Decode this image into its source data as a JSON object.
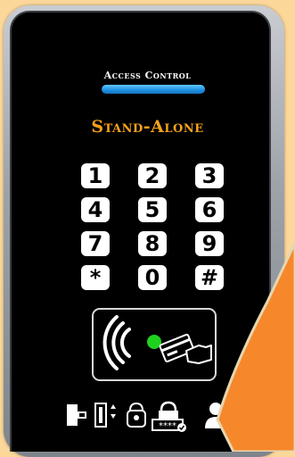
{
  "header": {
    "brand_label": "Access Control",
    "product_label": "Stand-Alone"
  },
  "keypad": {
    "keys": [
      "1",
      "2",
      "3",
      "4",
      "5",
      "6",
      "7",
      "8",
      "9",
      "*",
      "0",
      "#"
    ]
  },
  "reader": {
    "led_color": "#1fd11f"
  },
  "footer_icons": [
    "door-exit-icon",
    "elevator-icon",
    "hand-lock-icon",
    "password-lock-icon",
    "users-icon"
  ],
  "colors": {
    "accent_blue": "#1e8fe0",
    "accent_orange": "#f5a11c",
    "background": "#fbd79a",
    "corner_orange": "#f7872b"
  }
}
